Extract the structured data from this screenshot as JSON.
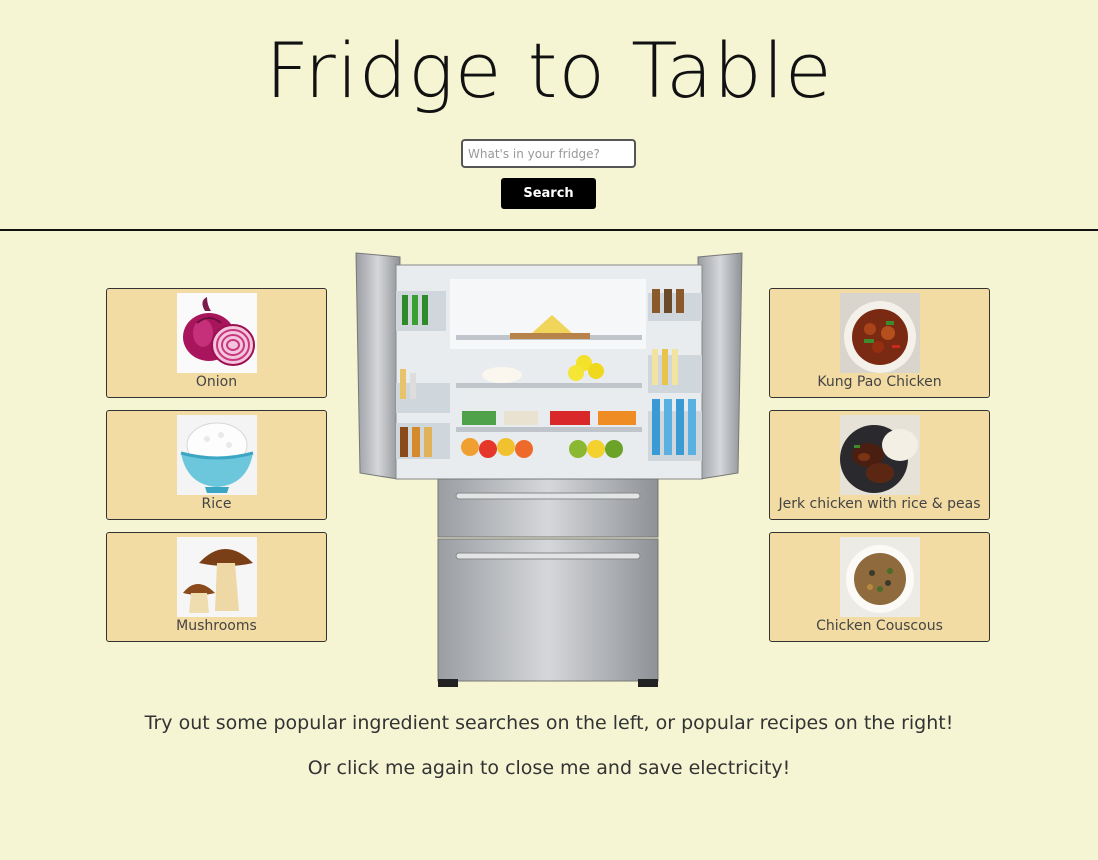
{
  "header": {
    "title": "Fridge to Table",
    "search_placeholder": "What's in your fridge?",
    "search_button": "Search"
  },
  "ingredients": [
    {
      "label": "Onion",
      "icon": "onion-icon"
    },
    {
      "label": "Rice",
      "icon": "rice-bowl-icon"
    },
    {
      "label": "Mushrooms",
      "icon": "mushroom-icon"
    }
  ],
  "recipes": [
    {
      "label": "Kung Pao Chicken",
      "icon": "kung-pao-chicken-photo"
    },
    {
      "label": "Jerk chicken with rice & peas",
      "icon": "jerk-chicken-photo"
    },
    {
      "label": "Chicken Couscous",
      "icon": "chicken-couscous-photo"
    }
  ],
  "footer": {
    "line1": "Try out some popular ingredient searches on the left, or popular recipes on the right!",
    "line2": "Or click me again to close me and save electricity!"
  },
  "colors": {
    "background": "#f5f5d4",
    "card": "#f3dca4",
    "button": "#000000"
  }
}
